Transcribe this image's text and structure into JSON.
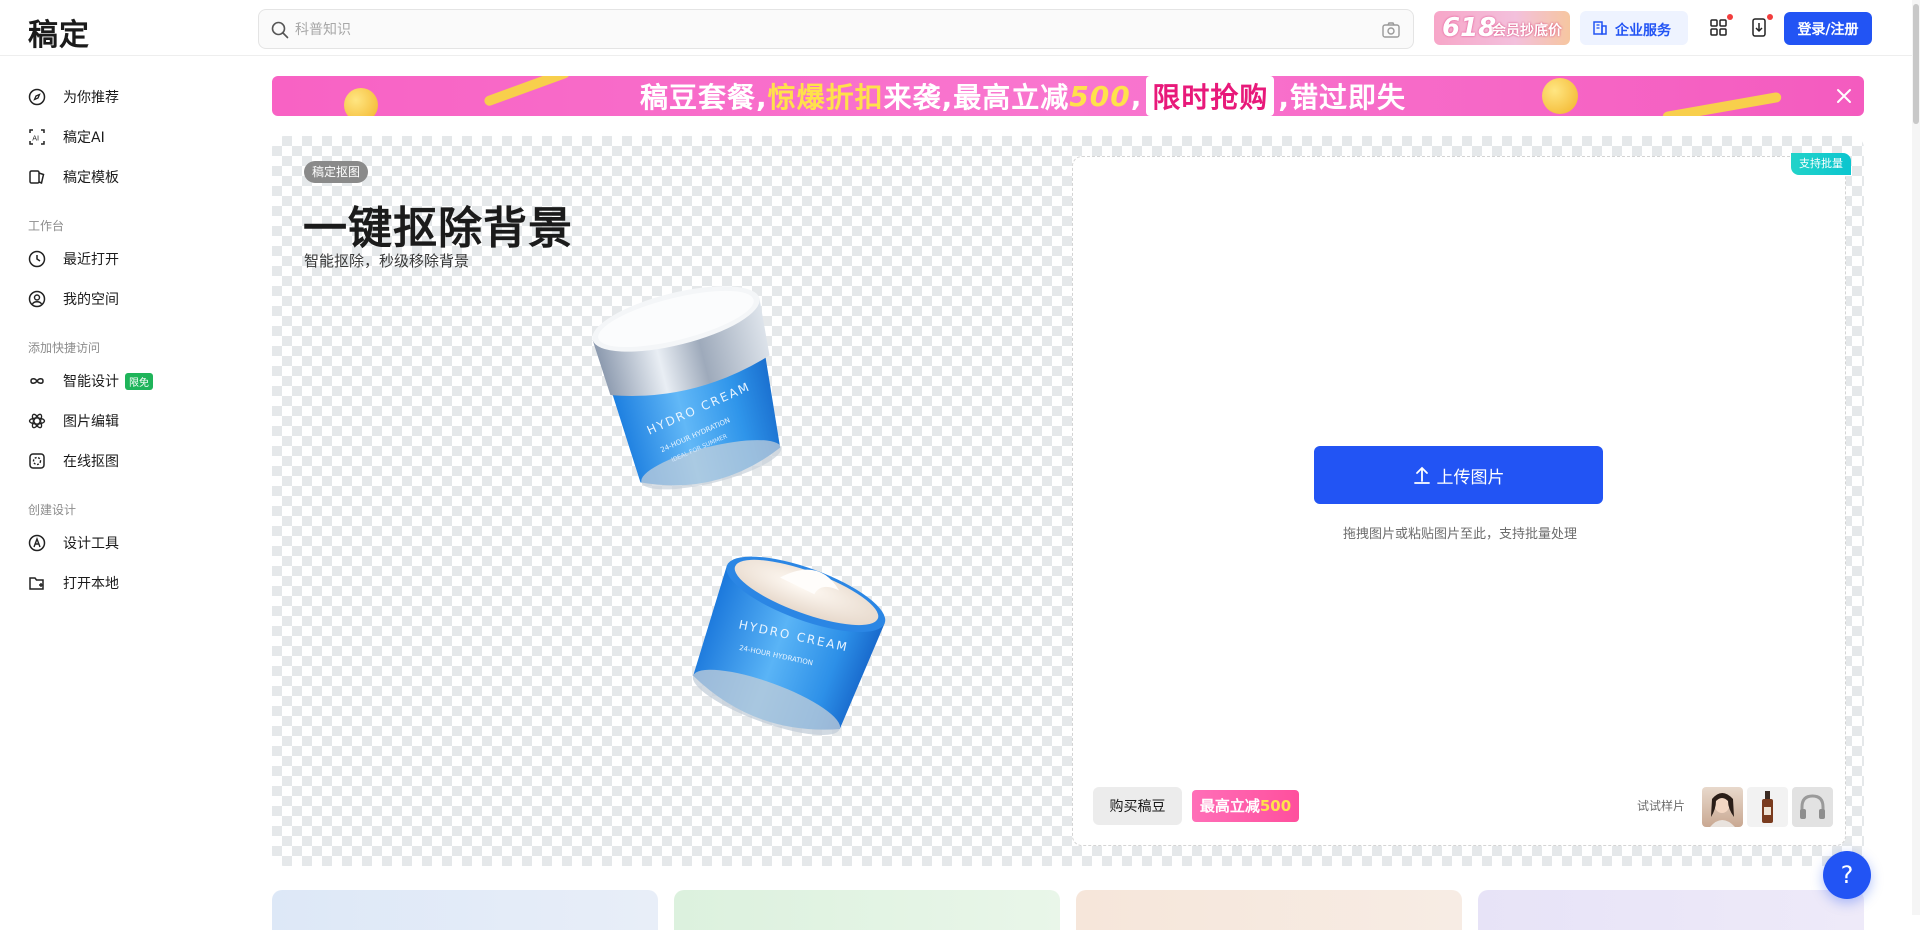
{
  "app": {
    "logo": "稿定"
  },
  "search": {
    "placeholder": "科普知识"
  },
  "header": {
    "promo_number": "618",
    "promo_text": "会员抄底价",
    "enterprise_label": "企业服务",
    "login_label": "登录/注册"
  },
  "sidebar": {
    "top_items": [
      {
        "label": "为你推荐",
        "icon": "compass-icon"
      },
      {
        "label": "稿定AI",
        "icon": "ai-icon"
      },
      {
        "label": "稿定模板",
        "icon": "template-icon"
      }
    ],
    "section_workspace": "工作台",
    "workspace_items": [
      {
        "label": "最近打开",
        "icon": "clock-icon"
      },
      {
        "label": "我的空间",
        "icon": "user-circle-icon"
      }
    ],
    "section_quick": "添加快捷访问",
    "quick_items": [
      {
        "label": "智能设计",
        "icon": "infinity-icon",
        "badge": "限免"
      },
      {
        "label": "图片编辑",
        "icon": "atom-icon"
      },
      {
        "label": "在线抠图",
        "icon": "cutout-icon"
      }
    ],
    "section_create": "创建设计",
    "create_items": [
      {
        "label": "设计工具",
        "icon": "pen-circle-icon"
      },
      {
        "label": "打开本地",
        "icon": "folder-plus-icon"
      }
    ]
  },
  "banner": {
    "part1": "稿豆套餐,",
    "part2": "惊爆折扣",
    "part3": "来袭,最高立减",
    "part4": "500",
    "part5": ",",
    "part6": "限时抢购",
    "part7": ",错过即失"
  },
  "hero": {
    "tag": "稿定抠图",
    "title": "一键抠除背景",
    "subtitle": "智能抠除，秒级移除背景",
    "jar_brand": "HYDRO CREAM",
    "jar_line1": "24-HOUR HYDRATION",
    "jar_line2": "IDEAL FOR SUMMER"
  },
  "upload": {
    "batch_tag": "支持批量",
    "button_label": "上传图片",
    "hint": "拖拽图片或粘贴图片至此，支持批量处理",
    "buy_label": "购买稿豆",
    "save_prefix": "最高立减",
    "save_value": "500",
    "sample_label": "试试样片"
  },
  "help": {
    "label": "?"
  },
  "colors": {
    "brand_blue": "#2254f4",
    "banner_pink": "#f862c4",
    "badge_green": "#1fb45a",
    "batch_teal": "#0bc5cf"
  }
}
